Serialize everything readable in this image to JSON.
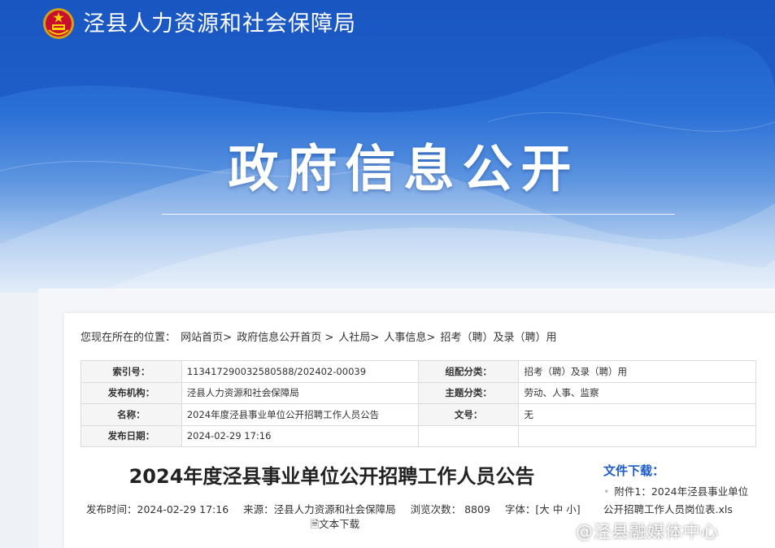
{
  "site": {
    "title": "泾县人力资源和社会保障局"
  },
  "hero": {
    "title": "政府信息公开"
  },
  "breadcrumb": {
    "prefix": "您现在所在的位置：",
    "items": [
      "网站首页>",
      "政府信息公开首页 >",
      "人社局>",
      "人事信息>",
      "招考（聘）及录（聘）用"
    ]
  },
  "meta": {
    "rows": [
      {
        "k1": "索引号：",
        "v1": "113417290032580588/202402-00039",
        "k2": "组配分类：",
        "v2": "招考（聘）及录（聘）用"
      },
      {
        "k1": "发布机构：",
        "v1": "泾县人力资源和社会保障局",
        "k2": "主题分类：",
        "v2": "劳动、人事、监察"
      },
      {
        "k1": "名称：",
        "v1": "2024年度泾县事业单位公开招聘工作人员公告",
        "k2": "文号：",
        "v2": "无"
      },
      {
        "k1": "发布日期：",
        "v1": "2024-02-29 17:16",
        "k2": "",
        "v2": ""
      }
    ]
  },
  "article": {
    "title": "2024年度泾县事业单位公开招聘工作人员公告",
    "publish_time": "发布时间：2024-02-29 17:16",
    "source": "来源：泾县人力资源和社会保障局",
    "views": "浏览次数： 8809",
    "font_size": "字体：[大 中 小]",
    "text_download": "文本下载"
  },
  "downloads": {
    "title": "文件下载：",
    "item": "附件1：2024年泾县事业单位公开招聘工作人员岗位表.xls"
  },
  "watermark": "@泾县融媒体中心",
  "colors": {
    "banner": "#1a5bc7",
    "accent": "#1a5bc7"
  }
}
